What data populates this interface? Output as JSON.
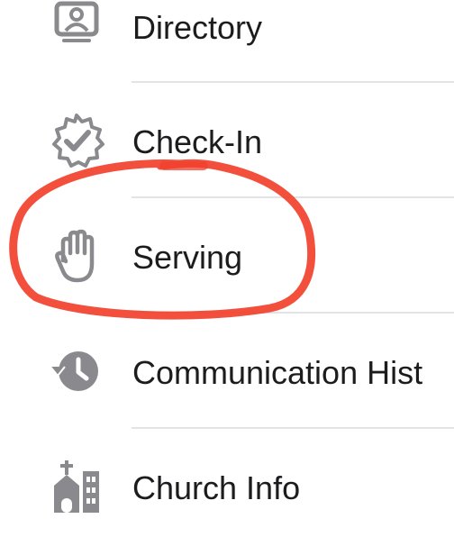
{
  "menu": {
    "items": [
      {
        "label": "Directory",
        "icon": "directory-icon"
      },
      {
        "label": "Check-In",
        "icon": "check-in-badge-icon"
      },
      {
        "label": "Serving",
        "icon": "hand-icon"
      },
      {
        "label": "Communication Hist",
        "icon": "history-clock-icon"
      },
      {
        "label": "Church Info",
        "icon": "church-icon"
      }
    ]
  },
  "colors": {
    "icon": "#8a8a8e",
    "text": "#1c1c1e",
    "divider": "#e3e3e6",
    "annotation": "#f2402c"
  }
}
